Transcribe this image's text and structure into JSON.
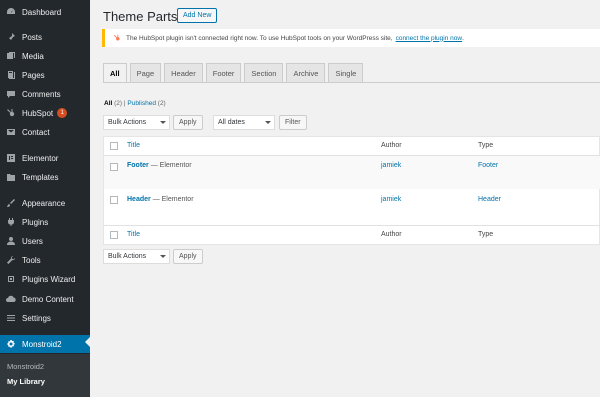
{
  "sidebar": {
    "items": [
      {
        "label": "Dashboard",
        "icon": "dashboard-icon"
      },
      {
        "label": "Posts",
        "icon": "pin-icon"
      },
      {
        "label": "Media",
        "icon": "media-icon"
      },
      {
        "label": "Pages",
        "icon": "pages-icon"
      },
      {
        "label": "Comments",
        "icon": "comment-icon"
      },
      {
        "label": "HubSpot",
        "icon": "hubspot-icon",
        "badge": "1"
      },
      {
        "label": "Contact",
        "icon": "mail-icon"
      },
      {
        "label": "Elementor",
        "icon": "elementor-icon"
      },
      {
        "label": "Templates",
        "icon": "folder-icon"
      },
      {
        "label": "Appearance",
        "icon": "brush-icon"
      },
      {
        "label": "Plugins",
        "icon": "plug-icon"
      },
      {
        "label": "Users",
        "icon": "user-icon"
      },
      {
        "label": "Tools",
        "icon": "wrench-icon"
      },
      {
        "label": "Plugins Wizard",
        "icon": "wizard-icon"
      },
      {
        "label": "Demo Content",
        "icon": "cloud-icon"
      },
      {
        "label": "Settings",
        "icon": "settings-icon"
      },
      {
        "label": "Monstroid2",
        "icon": "gear-icon"
      }
    ],
    "submenu": [
      "Monstroid2",
      "My Library"
    ]
  },
  "header": {
    "title": "Theme Parts",
    "add_new": "Add New"
  },
  "notice": {
    "text": "The HubSpot plugin isn't connected right now. To use HubSpot tools on your WordPress site,",
    "link": "connect the plugin now",
    "end": "."
  },
  "tabs": [
    "All",
    "Page",
    "Header",
    "Footer",
    "Section",
    "Archive",
    "Single"
  ],
  "filters": {
    "all": "All",
    "all_count": "(2)",
    "sep": "|",
    "published": "Published",
    "published_count": "(2)"
  },
  "controls": {
    "bulk_actions": "Bulk Actions",
    "apply": "Apply",
    "all_dates": "All dates",
    "filter": "Filter"
  },
  "table": {
    "headers": {
      "title": "Title",
      "author": "Author",
      "type": "Type"
    },
    "rows": [
      {
        "title": "Footer",
        "suffix": "— Elementor",
        "author": "jamiek",
        "type": "Footer"
      },
      {
        "title": "Header",
        "suffix": "— Elementor",
        "author": "jamiek",
        "type": "Header"
      }
    ]
  },
  "colors": {
    "accent": "#0073aa",
    "sidebar": "#23282d",
    "notice_border": "#ffb900"
  }
}
